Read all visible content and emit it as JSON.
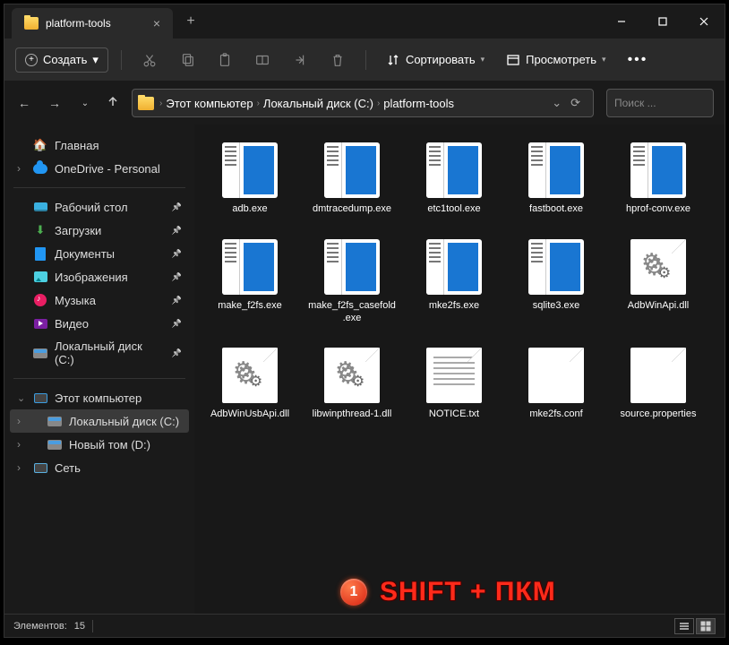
{
  "tab": {
    "title": "platform-tools"
  },
  "toolbar": {
    "create": "Создать",
    "sort": "Сортировать",
    "view": "Просмотреть"
  },
  "breadcrumb": {
    "items": [
      "Этот компьютер",
      "Локальный диск (C:)",
      "platform-tools"
    ]
  },
  "search": {
    "placeholder": "Поиск ..."
  },
  "sidebar": {
    "home": "Главная",
    "onedrive": "OneDrive - Personal",
    "quick": [
      "Рабочий стол",
      "Загрузки",
      "Документы",
      "Изображения",
      "Музыка",
      "Видео",
      "Локальный диск (C:)"
    ],
    "thispc": "Этот компьютер",
    "drives": [
      "Локальный диск (C:)",
      "Новый том (D:)"
    ],
    "network": "Сеть"
  },
  "files": [
    {
      "name": "adb.exe",
      "type": "exe"
    },
    {
      "name": "dmtracedump.exe",
      "type": "exe"
    },
    {
      "name": "etc1tool.exe",
      "type": "exe"
    },
    {
      "name": "fastboot.exe",
      "type": "exe"
    },
    {
      "name": "hprof-conv.exe",
      "type": "exe"
    },
    {
      "name": "make_f2fs.exe",
      "type": "exe"
    },
    {
      "name": "make_f2fs_casefold.exe",
      "type": "exe"
    },
    {
      "name": "mke2fs.exe",
      "type": "exe"
    },
    {
      "name": "sqlite3.exe",
      "type": "exe"
    },
    {
      "name": "AdbWinApi.dll",
      "type": "dll"
    },
    {
      "name": "AdbWinUsbApi.dll",
      "type": "dll"
    },
    {
      "name": "libwinpthread-1.dll",
      "type": "dll"
    },
    {
      "name": "NOTICE.txt",
      "type": "txt"
    },
    {
      "name": "mke2fs.conf",
      "type": "blank"
    },
    {
      "name": "source.properties",
      "type": "blank"
    }
  ],
  "status": {
    "count_label": "Элементов:",
    "count": "15"
  },
  "annotation": {
    "badge": "1",
    "text": "SHIFT + ПКМ"
  }
}
